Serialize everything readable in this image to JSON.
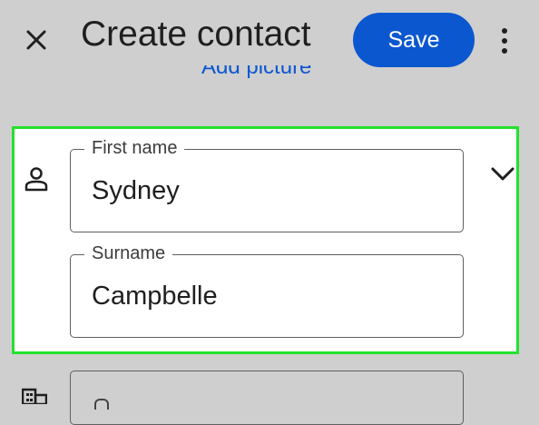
{
  "app_bar": {
    "title": "Create contact",
    "save_label": "Save",
    "close_icon": "close-icon",
    "more_icon": "more-vert-icon"
  },
  "add_picture": {
    "label": "Add picture"
  },
  "name_section": {
    "icon": "person-icon",
    "expand_icon": "chevron-down-icon",
    "first_name": {
      "label": "First name",
      "value": "Sydney"
    },
    "surname": {
      "label": "Surname",
      "value": "Campbelle"
    }
  },
  "company_section": {
    "icon": "company-icon"
  },
  "colors": {
    "background": "#cfcfcf",
    "accent": "#0b57d0",
    "highlight_border": "#22e22c",
    "field_border": "#5f5f5f",
    "text": "#1f1f1f"
  }
}
